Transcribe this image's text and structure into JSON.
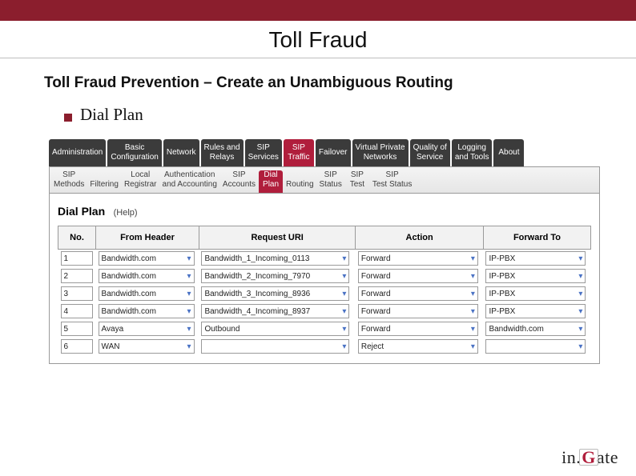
{
  "title": "Toll Fraud",
  "subtitle": "Toll Fraud Prevention – Create an Unambiguous Routing",
  "bullet": "Dial Plan",
  "main_tabs": [
    {
      "l1": "Administration"
    },
    {
      "l1": "Basic",
      "l2": "Configuration"
    },
    {
      "l1": "Network"
    },
    {
      "l1": "Rules and",
      "l2": "Relays"
    },
    {
      "l1": "SIP",
      "l2": "Services"
    },
    {
      "l1": "SIP",
      "l2": "Traffic",
      "active": true
    },
    {
      "l1": "Failover"
    },
    {
      "l1": "Virtual Private",
      "l2": "Networks"
    },
    {
      "l1": "Quality of",
      "l2": "Service"
    },
    {
      "l1": "Logging",
      "l2": "and Tools"
    },
    {
      "l1": "About"
    }
  ],
  "sub_tabs": [
    {
      "l1": "SIP",
      "l2": "Methods"
    },
    {
      "l1": "",
      "l2": "Filtering"
    },
    {
      "l1": "Local",
      "l2": "Registrar"
    },
    {
      "l1": "Authentication",
      "l2": "and Accounting"
    },
    {
      "l1": "SIP",
      "l2": "Accounts"
    },
    {
      "l1": "Dial",
      "l2": "Plan",
      "active": true
    },
    {
      "l1": "",
      "l2": "Routing"
    },
    {
      "l1": "SIP",
      "l2": "Status"
    },
    {
      "l1": "SIP",
      "l2": "Test"
    },
    {
      "l1": "SIP",
      "l2": "Test Status"
    }
  ],
  "section": {
    "title": "Dial Plan",
    "help": "(Help)"
  },
  "columns": {
    "no": "No.",
    "from": "From Header",
    "req": "Request URI",
    "act": "Action",
    "fwd": "Forward To"
  },
  "rows": [
    {
      "no": "1",
      "from": "Bandwidth.com",
      "req": "Bandwidth_1_Incoming_0113",
      "act": "Forward",
      "fwd": "IP-PBX"
    },
    {
      "no": "2",
      "from": "Bandwidth.com",
      "req": "Bandwidth_2_Incoming_7970",
      "act": "Forward",
      "fwd": "IP-PBX"
    },
    {
      "no": "3",
      "from": "Bandwidth.com",
      "req": "Bandwidth_3_Incoming_8936",
      "act": "Forward",
      "fwd": "IP-PBX"
    },
    {
      "no": "4",
      "from": "Bandwidth.com",
      "req": "Bandwidth_4_Incoming_8937",
      "act": "Forward",
      "fwd": "IP-PBX"
    },
    {
      "no": "5",
      "from": "Avaya",
      "req": "Outbound",
      "act": "Forward",
      "fwd": "Bandwidth.com"
    },
    {
      "no": "6",
      "from": "WAN",
      "req": "",
      "act": "Reject",
      "fwd": ""
    }
  ],
  "logo": {
    "pre": "in.",
    "g": "G",
    "post": "ate"
  }
}
